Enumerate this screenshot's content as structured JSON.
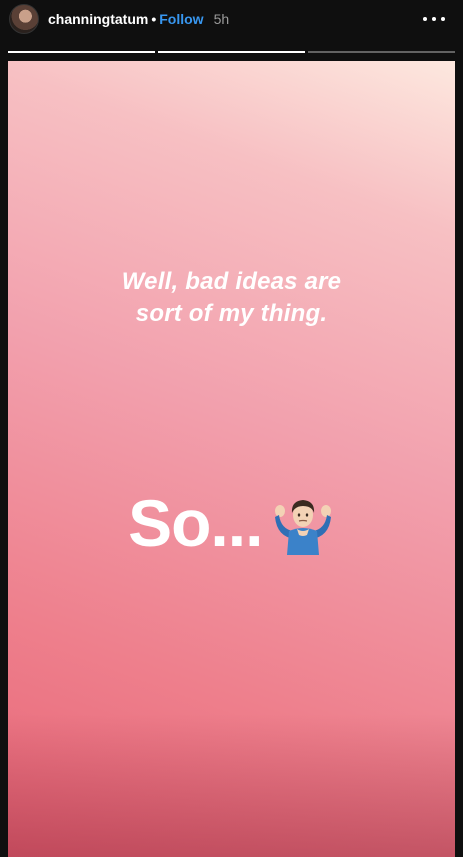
{
  "header": {
    "username": "channingtatum",
    "separator": "•",
    "follow_label": "Follow",
    "time": "5h"
  },
  "progress": {
    "segments": [
      1,
      1,
      0
    ]
  },
  "story": {
    "caption_line1": "Well, bad ideas are",
    "caption_line2": "sort of my thing.",
    "big_text": "So...",
    "emoji_icon": "person-shrugging-emoji"
  },
  "colors": {
    "follow": "#3897f0",
    "background": "#0f0f0f"
  }
}
